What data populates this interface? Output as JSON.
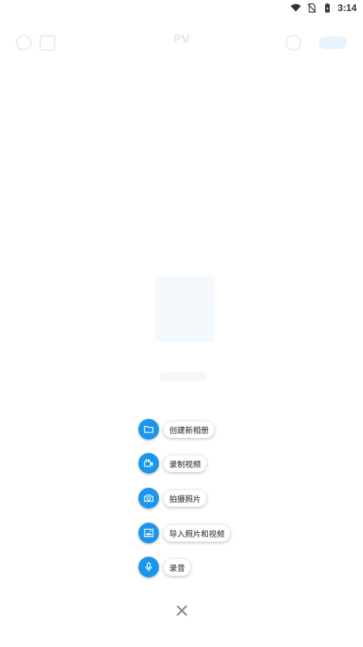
{
  "status_bar": {
    "time": "3:14",
    "icons": [
      "wifi-icon",
      "no-sim-icon",
      "battery-icon"
    ]
  },
  "background": {
    "title": "PV",
    "toolbar_left_icons": [
      "settings-icon",
      "gallery-icon"
    ],
    "toolbar_right_icons": [
      "search-icon"
    ],
    "pill_label": "",
    "subtitle": "",
    "empty_state_illustration": "empty-album-illustration"
  },
  "speed_dial": {
    "accent_color": "#1a96ee",
    "items": [
      {
        "label": "创建新相册",
        "icon": "folder-icon"
      },
      {
        "label": "录制视频",
        "icon": "video-camera-icon"
      },
      {
        "label": "拍摄照片",
        "icon": "camera-icon"
      },
      {
        "label": "导入照片和视频",
        "icon": "image-import-icon"
      },
      {
        "label": "录音",
        "icon": "microphone-icon"
      }
    ],
    "close_icon": "close-icon"
  }
}
